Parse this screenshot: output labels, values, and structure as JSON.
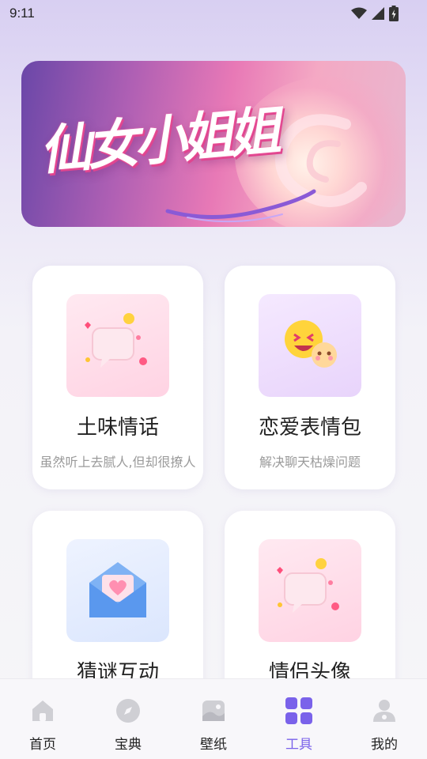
{
  "status_bar": {
    "time": "9:11"
  },
  "banner": {
    "title": "仙女小姐姐"
  },
  "cards": [
    {
      "title": "土味情话",
      "desc": "虽然听上去腻人,但却很撩人",
      "icon": "chat-bubble-hearts-icon"
    },
    {
      "title": "恋爱表情包",
      "desc": "解决聊天枯燥问题",
      "icon": "emoji-faces-icon"
    },
    {
      "title": "猜谜互动",
      "desc": "",
      "icon": "heart-envelope-icon"
    },
    {
      "title": "情侣头像",
      "desc": "",
      "icon": "chat-bubble-hearts-icon"
    }
  ],
  "tabbar": {
    "active": "工具",
    "accent": "#7a62ea",
    "items": [
      {
        "label": "首页",
        "icon": "home-icon"
      },
      {
        "label": "宝典",
        "icon": "compass-icon"
      },
      {
        "label": "壁纸",
        "icon": "wallpaper-icon"
      },
      {
        "label": "工具",
        "icon": "grid-icon"
      },
      {
        "label": "我的",
        "icon": "user-icon"
      }
    ]
  }
}
